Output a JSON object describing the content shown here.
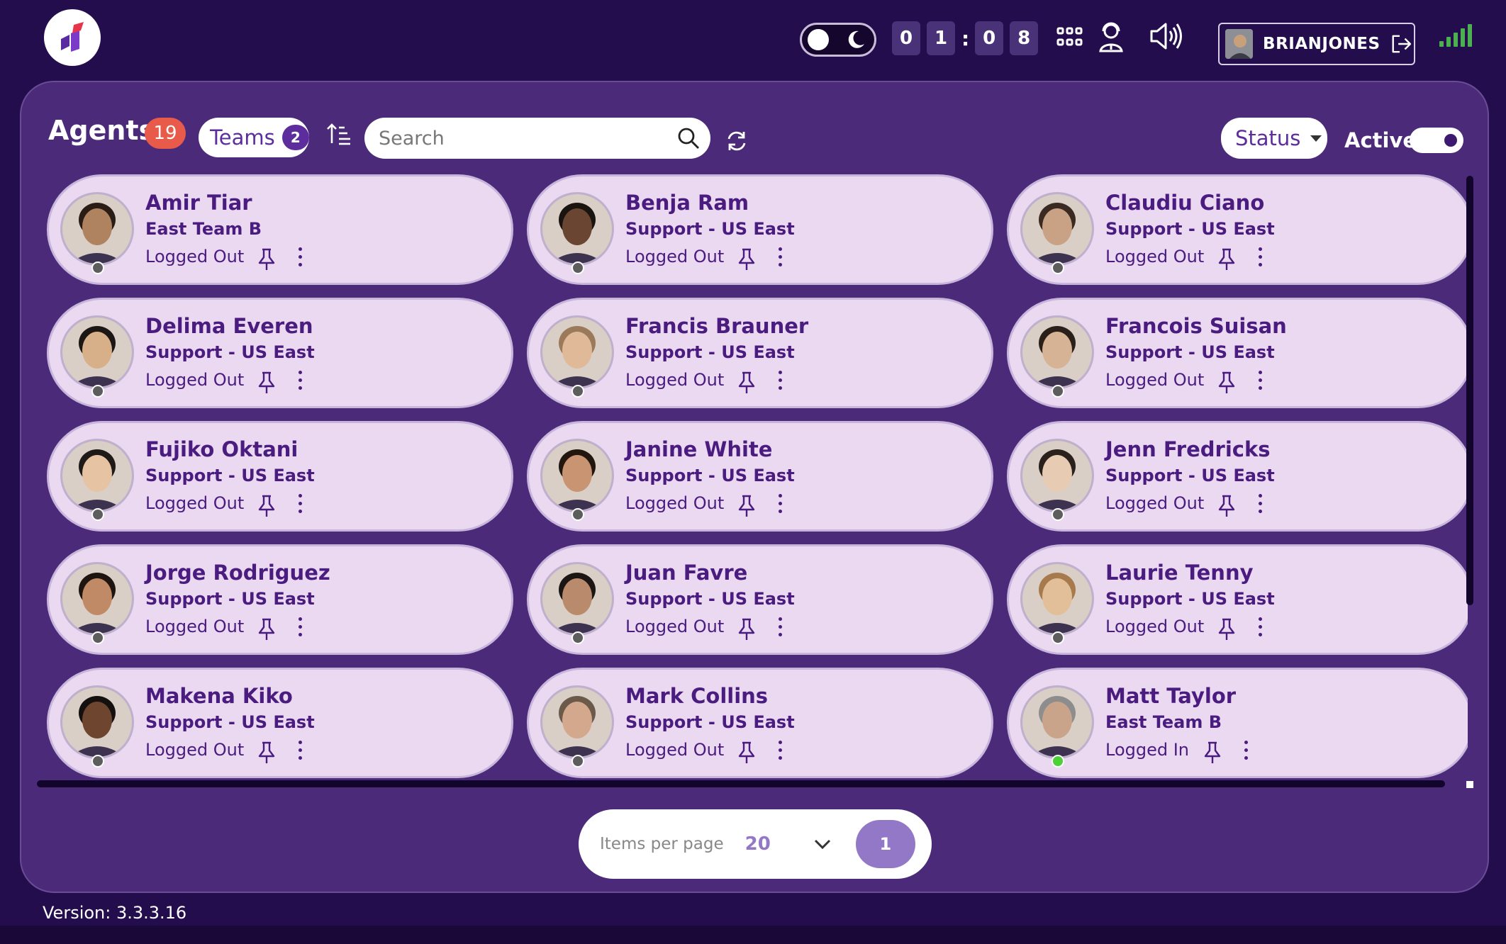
{
  "header": {
    "timer_digits": [
      "0",
      "1",
      "0",
      "8"
    ],
    "user": "BRIANJONES",
    "icons": [
      "apps-grid-icon",
      "agent-headset-icon",
      "volume-icon",
      "logout-icon",
      "signal-icon"
    ]
  },
  "toolbar": {
    "title": "Agents",
    "count": "19",
    "teams_label": "Teams",
    "teams_count": "2",
    "search_placeholder": "Search",
    "status_label": "Status",
    "active_label": "Active"
  },
  "agents": [
    {
      "name": "Amir Tiar",
      "team": "East Team B",
      "status": "Logged Out"
    },
    {
      "name": "Benja Ram",
      "team": "Support - US East",
      "status": "Logged Out"
    },
    {
      "name": "Claudiu Ciano",
      "team": "Support - US East",
      "status": "Logged Out"
    },
    {
      "name": "Delima Everen",
      "team": "Support - US East",
      "status": "Logged Out"
    },
    {
      "name": "Francis Brauner",
      "team": "Support - US East",
      "status": "Logged Out"
    },
    {
      "name": "Francois Suisan",
      "team": "Support - US East",
      "status": "Logged Out"
    },
    {
      "name": "Fujiko Oktani",
      "team": "Support - US East",
      "status": "Logged Out"
    },
    {
      "name": "Janine White",
      "team": "Support - US East",
      "status": "Logged Out"
    },
    {
      "name": "Jenn Fredricks",
      "team": "Support - US East",
      "status": "Logged Out"
    },
    {
      "name": "Jorge Rodriguez",
      "team": "Support - US East",
      "status": "Logged Out"
    },
    {
      "name": "Juan Favre",
      "team": "Support - US East",
      "status": "Logged Out"
    },
    {
      "name": "Laurie Tenny",
      "team": "Support - US East",
      "status": "Logged Out"
    },
    {
      "name": "Makena Kiko",
      "team": "Support - US East",
      "status": "Logged Out"
    },
    {
      "name": "Mark Collins",
      "team": "Support - US East",
      "status": "Logged Out"
    },
    {
      "name": "Matt Taylor",
      "team": "East Team B",
      "status": "Logged In"
    }
  ],
  "pagination": {
    "items_label": "Items per page",
    "items_value": "20",
    "page": "1"
  },
  "footer": {
    "version": "Version: 3.3.3.16"
  },
  "colors": {
    "background": "#240d4d",
    "panel": "#4b2b79",
    "card": "#ead9f1",
    "accent": "#5d2d9e",
    "badge": "#e85b4a",
    "online": "#4cd137",
    "offline": "#5d5d5d"
  }
}
